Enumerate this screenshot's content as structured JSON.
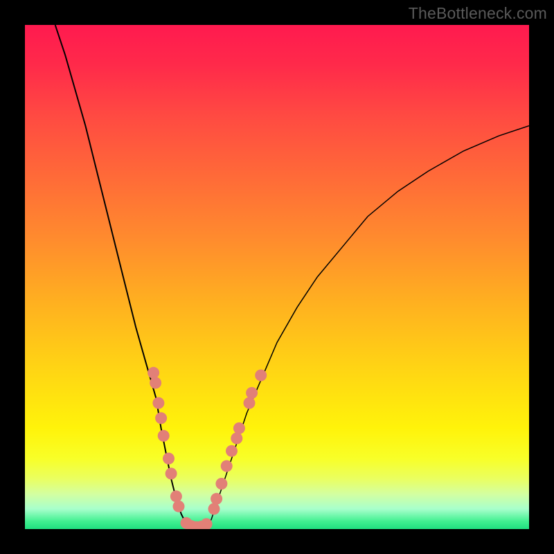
{
  "attribution": "TheBottleneck.com",
  "chart_data": {
    "type": "line",
    "title": "",
    "xlabel": "",
    "ylabel": "",
    "xlim": [
      0,
      100
    ],
    "ylim": [
      0,
      100
    ],
    "series": [
      {
        "name": "left-curve",
        "values_note": "Descending curve from upper-left toward bottom minimum",
        "points": [
          [
            6,
            100
          ],
          [
            8,
            94
          ],
          [
            10,
            87
          ],
          [
            12,
            80
          ],
          [
            14,
            72
          ],
          [
            16,
            64
          ],
          [
            18,
            56
          ],
          [
            20,
            48
          ],
          [
            22,
            40
          ],
          [
            24,
            33
          ],
          [
            26,
            26
          ],
          [
            27,
            20
          ],
          [
            28,
            15
          ],
          [
            29,
            10
          ],
          [
            30,
            6
          ],
          [
            31,
            3
          ],
          [
            32,
            1
          ],
          [
            33,
            0
          ]
        ]
      },
      {
        "name": "right-curve",
        "values_note": "Ascending curve from bottom minimum toward upper-right",
        "points": [
          [
            36,
            0
          ],
          [
            37,
            2
          ],
          [
            38,
            5
          ],
          [
            40,
            11
          ],
          [
            42,
            17
          ],
          [
            44,
            23
          ],
          [
            47,
            30
          ],
          [
            50,
            37
          ],
          [
            54,
            44
          ],
          [
            58,
            50
          ],
          [
            63,
            56
          ],
          [
            68,
            62
          ],
          [
            74,
            67
          ],
          [
            80,
            71
          ],
          [
            87,
            75
          ],
          [
            94,
            78
          ],
          [
            100,
            80
          ]
        ]
      }
    ],
    "markers": {
      "name": "data-points",
      "color": "#e28077",
      "radius_px": 8.5,
      "points": [
        [
          25.5,
          31
        ],
        [
          25.9,
          29
        ],
        [
          26.5,
          25
        ],
        [
          27,
          22
        ],
        [
          27.5,
          18.5
        ],
        [
          28.5,
          14
        ],
        [
          29,
          11
        ],
        [
          30,
          6.5
        ],
        [
          30.5,
          4.5
        ],
        [
          32,
          1.2
        ],
        [
          33,
          0.6
        ],
        [
          34,
          0.4
        ],
        [
          35,
          0.5
        ],
        [
          36,
          1
        ],
        [
          37.5,
          4
        ],
        [
          38,
          6
        ],
        [
          39,
          9
        ],
        [
          40,
          12.5
        ],
        [
          41,
          15.5
        ],
        [
          42,
          18
        ],
        [
          42.5,
          20
        ],
        [
          44.5,
          25
        ],
        [
          45,
          27
        ],
        [
          46.8,
          30.5
        ]
      ]
    }
  }
}
